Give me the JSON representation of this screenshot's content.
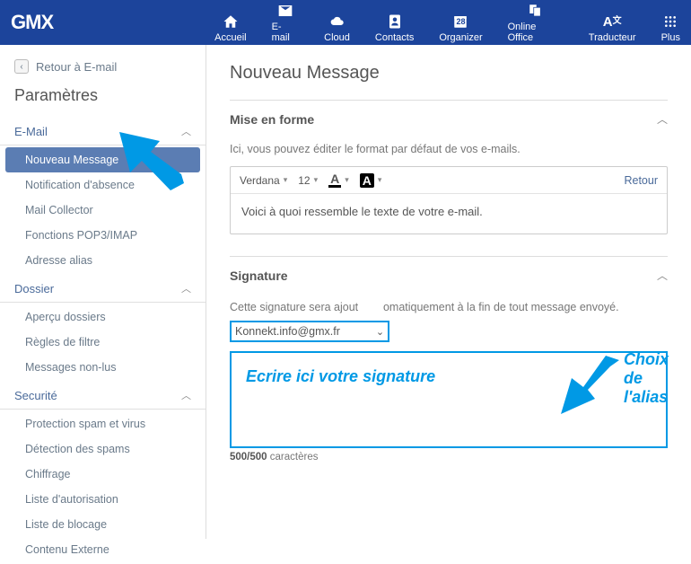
{
  "topbar": {
    "logo": "GMX",
    "items": [
      {
        "label": "Accueil",
        "icon": "home"
      },
      {
        "label": "E-mail",
        "icon": "mail"
      },
      {
        "label": "Cloud",
        "icon": "cloud"
      },
      {
        "label": "Contacts",
        "icon": "contacts"
      },
      {
        "label": "Organizer",
        "icon": "calendar",
        "badge": "28"
      },
      {
        "label": "Online Office",
        "icon": "office"
      },
      {
        "label": "Traducteur",
        "icon": "translate"
      },
      {
        "label": "Plus",
        "icon": "grid"
      }
    ]
  },
  "sidebar": {
    "back": "Retour à E-mail",
    "title": "Paramètres",
    "sections": [
      {
        "title": "E-Mail",
        "items": [
          "Nouveau Message",
          "Notification d'absence",
          "Mail Collector",
          "Fonctions POP3/IMAP",
          "Adresse alias"
        ],
        "active": 0
      },
      {
        "title": "Dossier",
        "items": [
          "Aperçu dossiers",
          "Règles de filtre",
          "Messages non-lus"
        ]
      },
      {
        "title": "Securité",
        "items": [
          "Protection spam et virus",
          "Détection des spams",
          "Chiffrage",
          "Liste d'autorisation",
          "Liste de blocage",
          "Contenu Externe"
        ]
      }
    ]
  },
  "content": {
    "title": "Nouveau Message",
    "format": {
      "heading": "Mise en forme",
      "desc": "Ici, vous pouvez éditer le format par défaut de vos e-mails.",
      "font": "Verdana",
      "size": "12",
      "back": "Retour",
      "sample": "Voici à quoi ressemble le texte de votre e-mail."
    },
    "signature": {
      "heading": "Signature",
      "desc_pre": "Cette signature sera ajout",
      "desc_post": "omatiquement à la fin de tout message envoyé.",
      "alias": "Konnekt.info@gmx.fr",
      "counter_num": "500/500",
      "counter_txt": " caractères"
    }
  },
  "annotations": {
    "alias_label": "Choix de l'alias",
    "sig_hint": "Ecrire ici votre signature"
  }
}
